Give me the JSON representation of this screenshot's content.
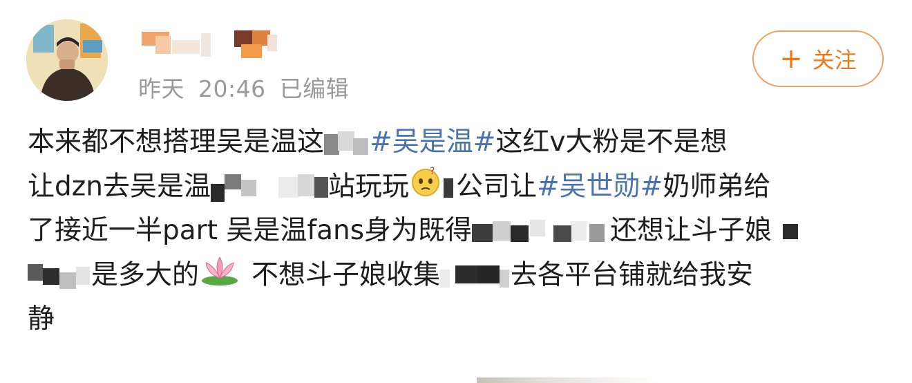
{
  "post": {
    "meta": {
      "date": "昨天",
      "time": "20:46",
      "edited": "已编辑"
    },
    "follow_button": {
      "icon": "plus-icon",
      "label": "关注"
    },
    "lines": [
      {
        "segments": [
          "本来都不想搭理吴是温这",
          "#吴是温#",
          "这红v大粉是不是想"
        ]
      },
      {
        "segments": [
          "让dzn去吴是温",
          "站玩玩",
          "公司让",
          "#吴世勋#",
          "奶师弟给"
        ]
      },
      {
        "segments": [
          "了接近一半part 吴是温fans身为既得",
          "还想让斗子娘"
        ]
      },
      {
        "segments": [
          "是多大的",
          "不想斗子娘收集",
          "去各平台铺就给我安"
        ]
      },
      {
        "segments": [
          "静"
        ]
      }
    ]
  },
  "colors": {
    "hashtag": "#4a73b0",
    "follow_accent": "#f07a1a",
    "meta_text": "#9a9a9a"
  }
}
